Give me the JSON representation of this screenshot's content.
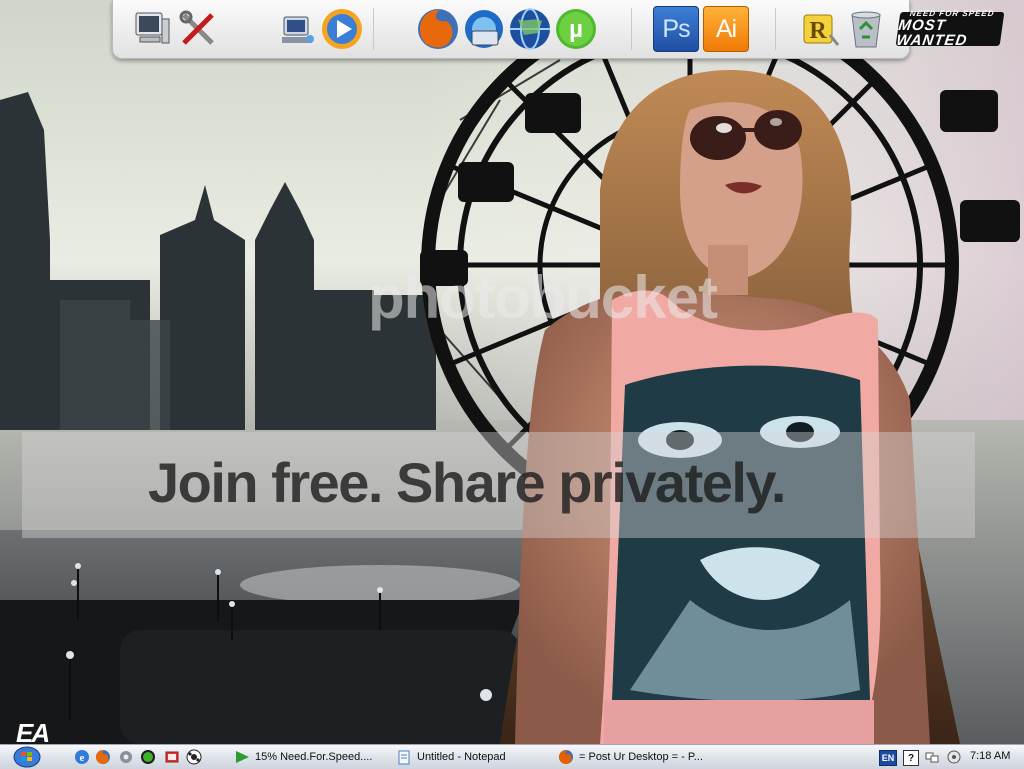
{
  "watermark": {
    "brand": "photobucket",
    "tagline": "Join free. Share privately."
  },
  "wallpaper": {
    "logo": "EA",
    "subject": "city-skyline-ferris-wheel-woman"
  },
  "dock": {
    "icons": [
      {
        "id": "my-computer",
        "icon": "computer-icon"
      },
      {
        "id": "tools",
        "icon": "tools-icon"
      },
      {
        "id": "network",
        "icon": "network-computer-icon"
      },
      {
        "id": "media-player",
        "icon": "media-player-icon"
      },
      {
        "id": "firefox",
        "icon": "firefox-icon"
      },
      {
        "id": "internet-explorer",
        "icon": "internet-explorer-icon"
      },
      {
        "id": "web-globe",
        "icon": "globe-icon"
      },
      {
        "id": "utorrent",
        "icon": "utorrent-icon",
        "label": "µ"
      },
      {
        "id": "photoshop",
        "icon": "photoshop-icon",
        "label": "Ps"
      },
      {
        "id": "illustrator",
        "icon": "illustrator-icon",
        "label": "Ai"
      },
      {
        "id": "rainlendar",
        "icon": "rainlendar-icon",
        "label": "R"
      },
      {
        "id": "recycle-bin",
        "icon": "recycle-bin-icon"
      }
    ],
    "nfs_logo": {
      "small": "NEED FOR SPEED",
      "big": "MOST WANTED"
    }
  },
  "taskbar": {
    "quick_launch": [
      "internet-explorer-icon",
      "firefox-icon",
      "settings-icon",
      "utorrent-icon",
      "messenger-icon",
      "media-icon"
    ],
    "tasks": [
      {
        "icon": "torrent-play-icon",
        "label": "15% Need.For.Speed....",
        "icon_color": "#2e9b2e"
      },
      {
        "icon": "notepad-icon",
        "label": "Untitled - Notepad",
        "icon_color": "#4a7fbf"
      },
      {
        "icon": "firefox-icon",
        "label": "= Post Ur Desktop = - P...",
        "icon_color": "#e66000"
      }
    ],
    "tray": {
      "language": "EN",
      "help": "?",
      "clock": "7:18 AM"
    }
  },
  "colors": {
    "dock_bg": "#efefef",
    "taskbar_bg": "#dfe3ea",
    "photoshop": "#2a63bf",
    "illustrator": "#f7931e"
  }
}
